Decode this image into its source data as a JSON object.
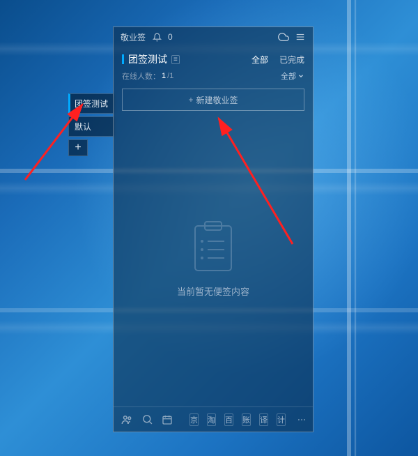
{
  "titlebar": {
    "app_name": "敬业签",
    "notif_count": "0"
  },
  "sidebar": {
    "tabs": [
      {
        "label": "团签测试",
        "active": true
      },
      {
        "label": "默认"
      }
    ],
    "add_label": "+"
  },
  "header": {
    "title": "团签测试",
    "badge": "≡",
    "filters": {
      "all": "全部",
      "done": "已完成"
    }
  },
  "subhead": {
    "label": "在线人数：",
    "current": "1",
    "sep": "/",
    "total": "1",
    "dropdown": "全部"
  },
  "new_button": {
    "plus": "+",
    "label": "新建敬业签"
  },
  "empty": {
    "text": "当前暂无便签内容"
  },
  "footer": {
    "shortcuts": [
      "京",
      "淘",
      "百",
      "账",
      "译",
      "计"
    ]
  }
}
